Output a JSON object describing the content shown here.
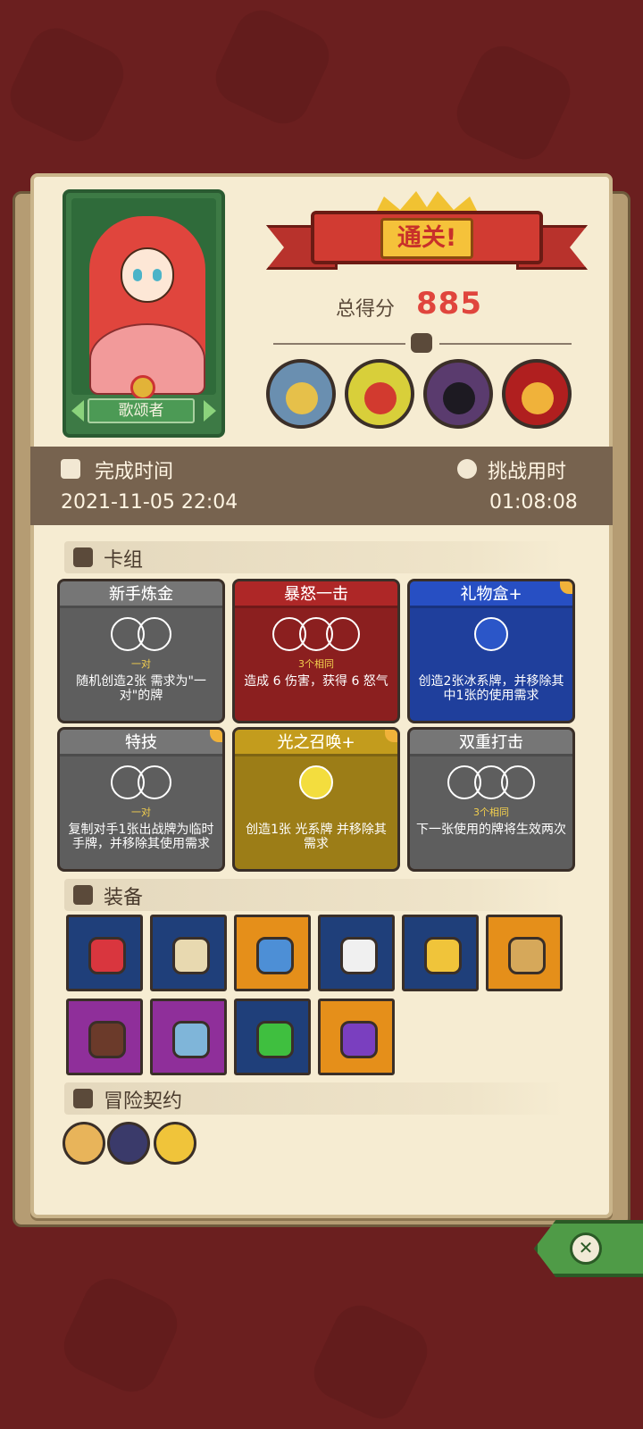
{
  "result": {
    "banner_title": "通关!",
    "score_label": "总得分",
    "score_value": "885"
  },
  "hero": {
    "name": "歌颂者"
  },
  "times": {
    "finish_label": "完成时间",
    "finish_value": "2021-11-05 22:04",
    "duration_label": "挑战用时",
    "duration_value": "01:08:08"
  },
  "deck": {
    "title": "卡组",
    "cards": [
      {
        "name": "新手炼金",
        "sub": "一对",
        "desc": "随机创造2张 需求为\"一对\"的牌",
        "color": "#5e5e5e"
      },
      {
        "name": "暴怒一击",
        "sub": "3个相同",
        "desc": "造成 6 伤害，获得 6 怒气",
        "color": "#8b1f1f"
      },
      {
        "name": "礼物盒+",
        "sub": "",
        "desc": "创造2张冰系牌，并移除其中1张的使用需求",
        "color": "#1f3f9c"
      },
      {
        "name": "特技",
        "sub": "一对",
        "desc": "复制对手1张出战牌为临时手牌，并移除其使用需求",
        "color": "#5e5e5e"
      },
      {
        "name": "光之召唤+",
        "sub": "",
        "desc": "创造1张 光系牌 并移除其需求",
        "color": "#9c7d17"
      },
      {
        "name": "双重打击",
        "sub": "3个相同",
        "desc": "下一张使用的牌将生效两次",
        "color": "#5e5e5e"
      }
    ]
  },
  "equipment": {
    "title": "装备",
    "items": [
      {
        "icon": "ruby-gem-icon",
        "bg": "#1f3f7a",
        "fg": "#d9363e"
      },
      {
        "icon": "scroll-map-icon",
        "bg": "#1f3f7a",
        "fg": "#e8d9b0"
      },
      {
        "icon": "blue-stone-icon",
        "bg": "#e58f1a",
        "fg": "#4d8fd6"
      },
      {
        "icon": "skull-helmet-icon",
        "bg": "#1f3f7a",
        "fg": "#f0f0f0"
      },
      {
        "icon": "gold-helmet-icon",
        "bg": "#1f3f7a",
        "fg": "#f0c43a"
      },
      {
        "icon": "coin-sack-icon",
        "bg": "#e58f1a",
        "fg": "#d6a85a"
      },
      {
        "icon": "button-icon",
        "bg": "#8f2f9a",
        "fg": "#6b3a2a"
      },
      {
        "icon": "dagger-icon",
        "bg": "#8f2f9a",
        "fg": "#7fb5d9"
      },
      {
        "icon": "emerald-gem-icon",
        "bg": "#1f3f7a",
        "fg": "#3fbf3f"
      },
      {
        "icon": "purple-cloak-icon",
        "bg": "#e58f1a",
        "fg": "#7a3fbf"
      }
    ]
  },
  "contracts": {
    "title": "冒险契约",
    "items": [
      {
        "icon": "scroll-contract-icon",
        "color": "#e8b45a"
      },
      {
        "icon": "hammer-contract-icon",
        "color": "#3a3a6a"
      },
      {
        "icon": "gold-coin-contract-icon",
        "color": "#f0c43a"
      }
    ]
  }
}
